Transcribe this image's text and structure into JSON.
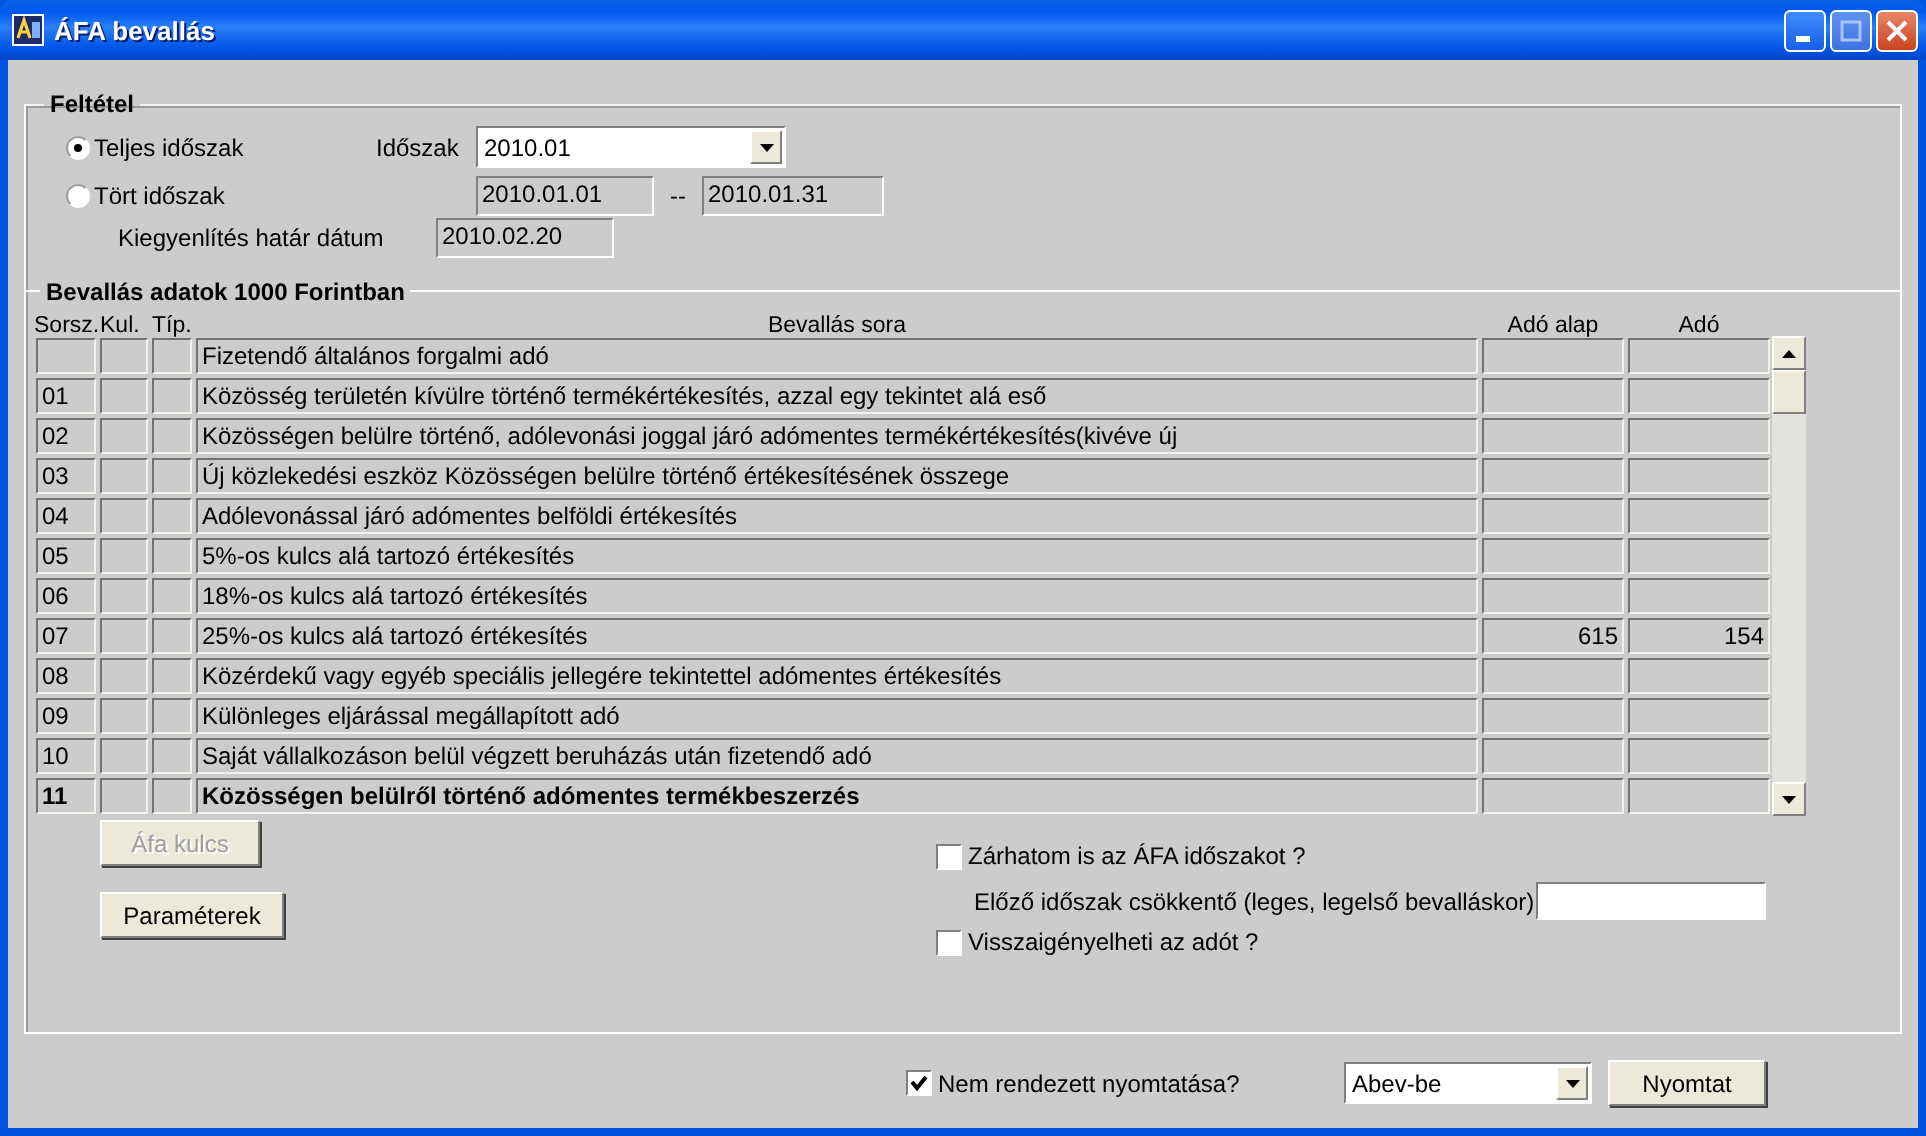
{
  "window": {
    "title": "ÁFA bevallás"
  },
  "criteria": {
    "title": "Feltétel",
    "options": [
      {
        "label": "Teljes időszak",
        "selected": true
      },
      {
        "label": "Tört időszak",
        "selected": false
      }
    ],
    "period": {
      "label": "Időszak",
      "value": "2010.01"
    },
    "date_from": "2010.01.01",
    "separator": "--",
    "date_to": "2010.01.31",
    "due_date": {
      "label": "Kiegyenlítés határ dátum",
      "value": "2010.02.20"
    }
  },
  "table": {
    "title": "Bevallás adatok 1000 Forintban",
    "columns": [
      "Sorsz.",
      "Kul.",
      "Típ.",
      "Bevallás sora",
      "Adó alap",
      "Adó"
    ],
    "rows": [
      {
        "text": "Fizetendő általános forgalmi adó",
        "bold": false
      },
      {
        "no": "01",
        "text": "Közösség területén kívülre történő termékértékesítés, azzal egy tekintet alá eső",
        "bold": false
      },
      {
        "no": "02",
        "text": "Közösségen belülre történő, adólevonási joggal járó adómentes termékértékesítés(kivéve új",
        "bold": false
      },
      {
        "no": "03",
        "text": "Új közlekedési eszköz Közösségen belülre történő értékesítésének összege",
        "bold": false
      },
      {
        "no": "04",
        "text": "Adólevonással járó adómentes belföldi értékesítés",
        "bold": false
      },
      {
        "no": "05",
        "text": "5%-os kulcs alá tartozó értékesítés",
        "bold": false
      },
      {
        "no": "06",
        "text": "18%-os kulcs alá tartozó értékesítés",
        "bold": false
      },
      {
        "no": "07",
        "text": "25%-os kulcs alá tartozó értékesítés",
        "base": "615",
        "tax": "154",
        "bold": false
      },
      {
        "no": "08",
        "text": "Közérdekű vagy egyéb speciális jellegére tekintettel adómentes értékesítés",
        "bold": false
      },
      {
        "no": "09",
        "text": "Különleges eljárással megállapított adó",
        "bold": false
      },
      {
        "no": "10",
        "text": "Saját vállalkozáson belül végzett beruházás után fizetendő adó",
        "bold": false
      },
      {
        "no": "11",
        "text": "Közösségen belülről történő adómentes termékbeszerzés",
        "bold": true
      }
    ]
  },
  "buttons": [
    {
      "label": "Áfa kulcs",
      "disabled": true
    },
    {
      "label": "Paraméterek",
      "disabled": false
    }
  ],
  "settings": {
    "close_period": {
      "label": "Zárhatom is az ÁFA időszakot ?",
      "checked": false
    },
    "previous_reduction": {
      "label": "Előző időszak csökkentő (leges, legelső bevalláskor)"
    },
    "reclaim": {
      "label": "Visszaigényelheti az adót ?",
      "checked": false
    }
  },
  "footer": {
    "unsorted_print": {
      "label": "Nem rendezett nyomtatása?",
      "checked": true
    },
    "output": {
      "value": "Abev-be"
    },
    "print_button": "Nyomtat"
  }
}
